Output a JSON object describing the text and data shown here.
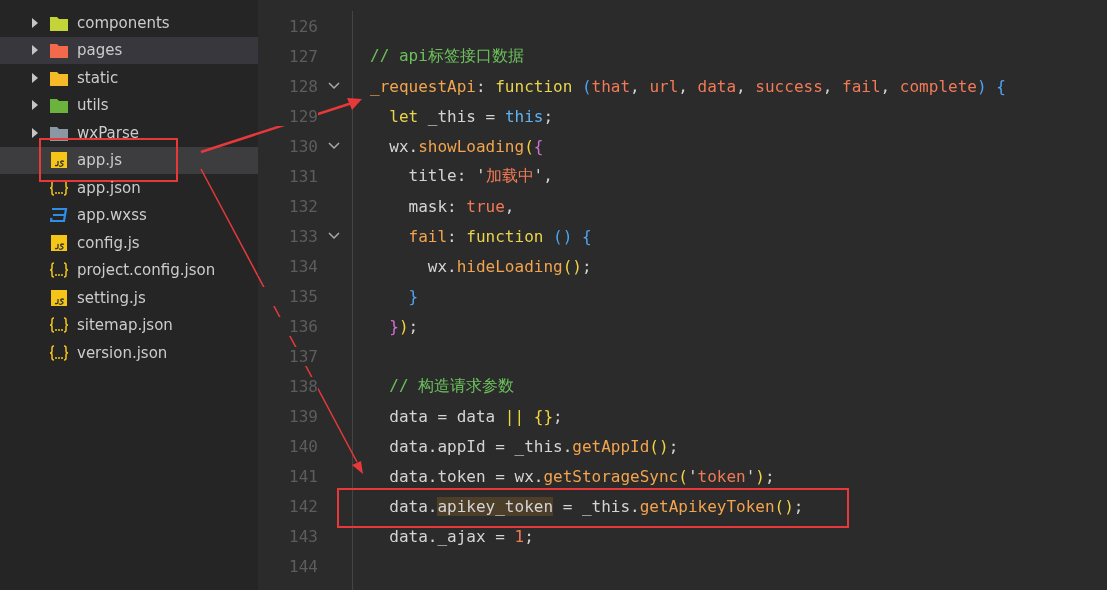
{
  "sidebar": {
    "items": [
      {
        "label": "components",
        "kind": "folder",
        "color": "#c3d437",
        "expanded": false,
        "selected": false,
        "hovered": false
      },
      {
        "label": "pages",
        "kind": "folder",
        "color": "#f2694b",
        "expanded": false,
        "selected": false,
        "hovered": true
      },
      {
        "label": "static",
        "kind": "folder",
        "color": "#f6b928",
        "expanded": false,
        "selected": false,
        "hovered": false
      },
      {
        "label": "utils",
        "kind": "folder",
        "color": "#6cb33e",
        "expanded": false,
        "selected": false,
        "hovered": false
      },
      {
        "label": "wxParse",
        "kind": "folder",
        "color": "#8a98a4",
        "expanded": false,
        "selected": false,
        "hovered": false
      },
      {
        "label": "app.js",
        "kind": "js",
        "selected": true,
        "hovered": false
      },
      {
        "label": "app.json",
        "kind": "json",
        "selected": false,
        "hovered": false
      },
      {
        "label": "app.wxss",
        "kind": "wxss",
        "selected": false,
        "hovered": false
      },
      {
        "label": "config.js",
        "kind": "js",
        "selected": false,
        "hovered": false
      },
      {
        "label": "project.config.json",
        "kind": "json",
        "selected": false,
        "hovered": false
      },
      {
        "label": "setting.js",
        "kind": "js",
        "selected": false,
        "hovered": false
      },
      {
        "label": "sitemap.json",
        "kind": "json",
        "selected": false,
        "hovered": false
      },
      {
        "label": "version.json",
        "kind": "json",
        "selected": false,
        "hovered": false
      }
    ]
  },
  "editor": {
    "lines": [
      {
        "number": "126",
        "foldable": false
      },
      {
        "number": "127",
        "foldable": false,
        "tokens": [
          {
            "kind": "comment",
            "text": "// api标签接口数据"
          }
        ]
      },
      {
        "number": "128",
        "foldable": true,
        "tokens": [
          {
            "kind": "property",
            "text": "_requestApi"
          },
          {
            "kind": "plain",
            "text": ": "
          },
          {
            "kind": "keyword",
            "text": "function "
          },
          {
            "kind": "bracket3",
            "text": "("
          },
          {
            "kind": "param",
            "text": "that"
          },
          {
            "kind": "plain",
            "text": ", "
          },
          {
            "kind": "param",
            "text": "url"
          },
          {
            "kind": "plain",
            "text": ", "
          },
          {
            "kind": "param",
            "text": "data"
          },
          {
            "kind": "plain",
            "text": ", "
          },
          {
            "kind": "param",
            "text": "success"
          },
          {
            "kind": "plain",
            "text": ", "
          },
          {
            "kind": "param",
            "text": "fail"
          },
          {
            "kind": "plain",
            "text": ", "
          },
          {
            "kind": "param",
            "text": "complete"
          },
          {
            "kind": "bracket3",
            "text": ") {"
          }
        ]
      },
      {
        "number": "129",
        "foldable": false,
        "tokens": [
          {
            "kind": "keyword",
            "text": "  let"
          },
          {
            "kind": "plain",
            "text": " _this = "
          },
          {
            "kind": "this",
            "text": "this"
          },
          {
            "kind": "plain",
            "text": ";"
          }
        ]
      },
      {
        "number": "130",
        "foldable": true,
        "tokens": [
          {
            "kind": "plain",
            "text": "  wx."
          },
          {
            "kind": "property",
            "text": "showLoading"
          },
          {
            "kind": "bracket1",
            "text": "("
          },
          {
            "kind": "bracket2",
            "text": "{"
          }
        ]
      },
      {
        "number": "131",
        "foldable": false,
        "tokens": [
          {
            "kind": "plain",
            "text": "    title: '"
          },
          {
            "kind": "string",
            "text": "加载中"
          },
          {
            "kind": "plain",
            "text": "',"
          }
        ]
      },
      {
        "number": "132",
        "foldable": false,
        "tokens": [
          {
            "kind": "plain",
            "text": "    mask: "
          },
          {
            "kind": "number",
            "text": "true"
          },
          {
            "kind": "plain",
            "text": ","
          }
        ]
      },
      {
        "number": "133",
        "foldable": true,
        "tokens": [
          {
            "kind": "property",
            "text": "    fail"
          },
          {
            "kind": "plain",
            "text": ": "
          },
          {
            "kind": "keyword",
            "text": "function "
          },
          {
            "kind": "bracket3",
            "text": "() {"
          }
        ]
      },
      {
        "number": "134",
        "foldable": false,
        "tokens": [
          {
            "kind": "plain",
            "text": "      wx."
          },
          {
            "kind": "property",
            "text": "hideLoading"
          },
          {
            "kind": "bracket1",
            "text": "()"
          },
          {
            "kind": "plain",
            "text": ";"
          }
        ]
      },
      {
        "number": "135",
        "foldable": false,
        "tokens": [
          {
            "kind": "bracket3",
            "text": "    }"
          }
        ]
      },
      {
        "number": "136",
        "foldable": false,
        "tokens": [
          {
            "kind": "bracket2",
            "text": "  }"
          },
          {
            "kind": "bracket1",
            "text": ")"
          },
          {
            "kind": "plain",
            "text": ";"
          }
        ]
      },
      {
        "number": "137",
        "foldable": false
      },
      {
        "number": "138",
        "foldable": false,
        "tokens": [
          {
            "kind": "comment",
            "text": "  // 构造请求参数"
          }
        ]
      },
      {
        "number": "139",
        "foldable": false,
        "tokens": [
          {
            "kind": "plain",
            "text": "  data = data "
          },
          {
            "kind": "bracket1",
            "text": "|| {}"
          },
          {
            "kind": "plain",
            "text": ";"
          }
        ]
      },
      {
        "number": "140",
        "foldable": false,
        "tokens": [
          {
            "kind": "plain",
            "text": "  data.appId = _this."
          },
          {
            "kind": "property",
            "text": "getAppId"
          },
          {
            "kind": "bracket1",
            "text": "()"
          },
          {
            "kind": "plain",
            "text": ";"
          }
        ]
      },
      {
        "number": "141",
        "foldable": false,
        "tokens": [
          {
            "kind": "plain",
            "text": "  data.token = wx."
          },
          {
            "kind": "property",
            "text": "getStorageSync"
          },
          {
            "kind": "bracket1",
            "text": "("
          },
          {
            "kind": "plain",
            "text": "'"
          },
          {
            "kind": "string",
            "text": "token"
          },
          {
            "kind": "plain",
            "text": "'"
          },
          {
            "kind": "bracket1",
            "text": ")"
          },
          {
            "kind": "plain",
            "text": ";"
          }
        ]
      },
      {
        "number": "142",
        "foldable": false,
        "tokens": [
          {
            "kind": "plain",
            "text": "  data."
          },
          {
            "kind": "match",
            "text": "apikey_token"
          },
          {
            "kind": "plain",
            "text": " = _this."
          },
          {
            "kind": "property",
            "text": "getApikeyToken"
          },
          {
            "kind": "bracket1",
            "text": "()"
          },
          {
            "kind": "plain",
            "text": ";"
          }
        ]
      },
      {
        "number": "143",
        "foldable": false,
        "tokens": [
          {
            "kind": "plain",
            "text": "  data._ajax = "
          },
          {
            "kind": "number",
            "text": "1"
          },
          {
            "kind": "plain",
            "text": ";"
          }
        ]
      },
      {
        "number": "144",
        "foldable": false
      }
    ]
  }
}
